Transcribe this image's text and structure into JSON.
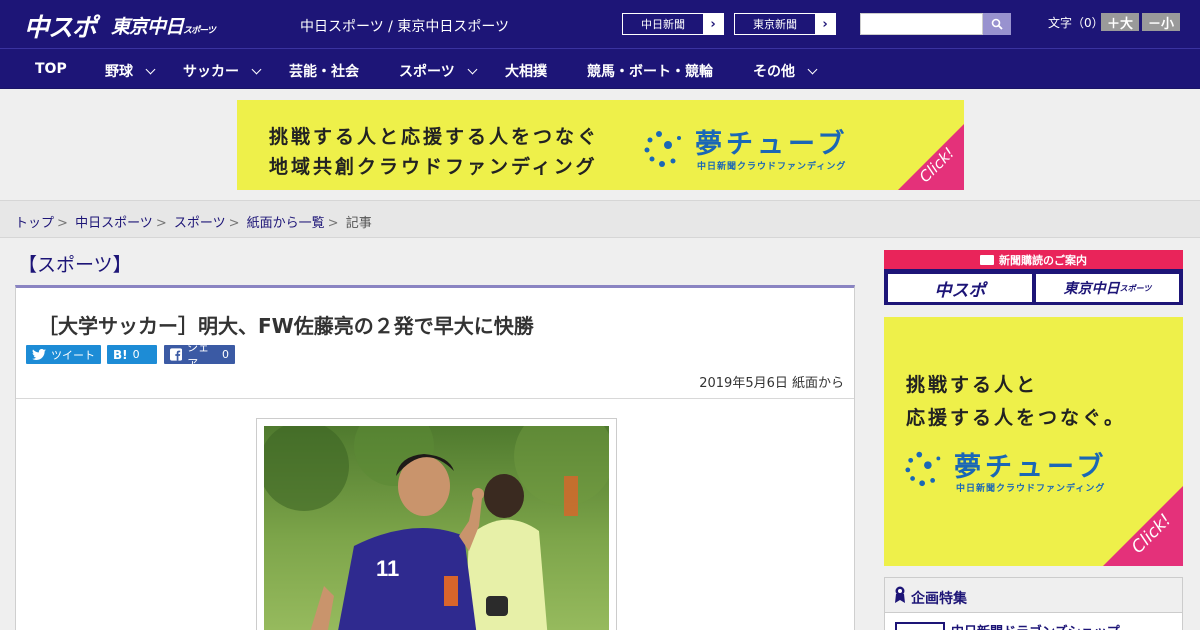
{
  "header": {
    "logo_chuspo": "中スポ",
    "logo_tokyo": "東京中日",
    "logo_tokyo_small": "スポーツ",
    "site_link": "中日スポーツ / 東京中日スポーツ",
    "paper_buttons": [
      {
        "label": "中日新聞"
      },
      {
        "label": "東京新聞"
      }
    ],
    "search_placeholder": "",
    "font_size_label": "文字（0）",
    "font_bigger": "＋大",
    "font_smaller": "－小"
  },
  "nav": [
    {
      "label": "TOP",
      "has_menu": false
    },
    {
      "label": "野球",
      "has_menu": true
    },
    {
      "label": "サッカー",
      "has_menu": true
    },
    {
      "label": "芸能・社会",
      "has_menu": false
    },
    {
      "label": "スポーツ",
      "has_menu": true
    },
    {
      "label": "大相撲",
      "has_menu": false
    },
    {
      "label": "競馬・ボート・競輪",
      "has_menu": false
    },
    {
      "label": "その他",
      "has_menu": true
    }
  ],
  "ad_top": {
    "line1": "挑戦する人と応援する人をつなぐ",
    "line2": "地域共創クラウドファンディング",
    "brand": "夢チューブ",
    "brand_sub": "中日新聞クラウドファンディング",
    "click": "Click!"
  },
  "breadcrumb": [
    {
      "label": "トップ",
      "link": true
    },
    {
      "label": "中日スポーツ",
      "link": true
    },
    {
      "label": "スポーツ",
      "link": true
    },
    {
      "label": "紙面から一覧",
      "link": true
    },
    {
      "label": "記事",
      "link": false
    }
  ],
  "article": {
    "category": "【スポーツ】",
    "title": "［大学サッカー］明大、FW佐藤亮の２発で早大に快勝",
    "share": {
      "tweet": "ツイート",
      "hatena_icon": "B!",
      "hatena_count": "0",
      "facebook": "シェア",
      "facebook_count": "0"
    },
    "date": "2019年5月6日 紙面から",
    "player_number": "11"
  },
  "sidebar": {
    "subscription_head": "新聞購読のご案内",
    "sub_chuspo": "中スポ",
    "sub_tokyo": "東京中日",
    "sub_tokyo_small": "スポーツ",
    "ad": {
      "line1": "挑戦する人と",
      "line2": "応援する人をつなぐ。",
      "brand": "夢チューブ",
      "brand_sub": "中日新聞クラウドファンディング",
      "click": "Click!"
    },
    "feature_head": "企画特集",
    "feature_item": "中日新聞ドラゴンズショップ"
  },
  "colors": {
    "brand_navy": "#1d1577",
    "accent_pink": "#e4317a",
    "ad_yellow": "#eef04a",
    "twitter": "#1d8cd6",
    "facebook": "#3b5aa4"
  }
}
